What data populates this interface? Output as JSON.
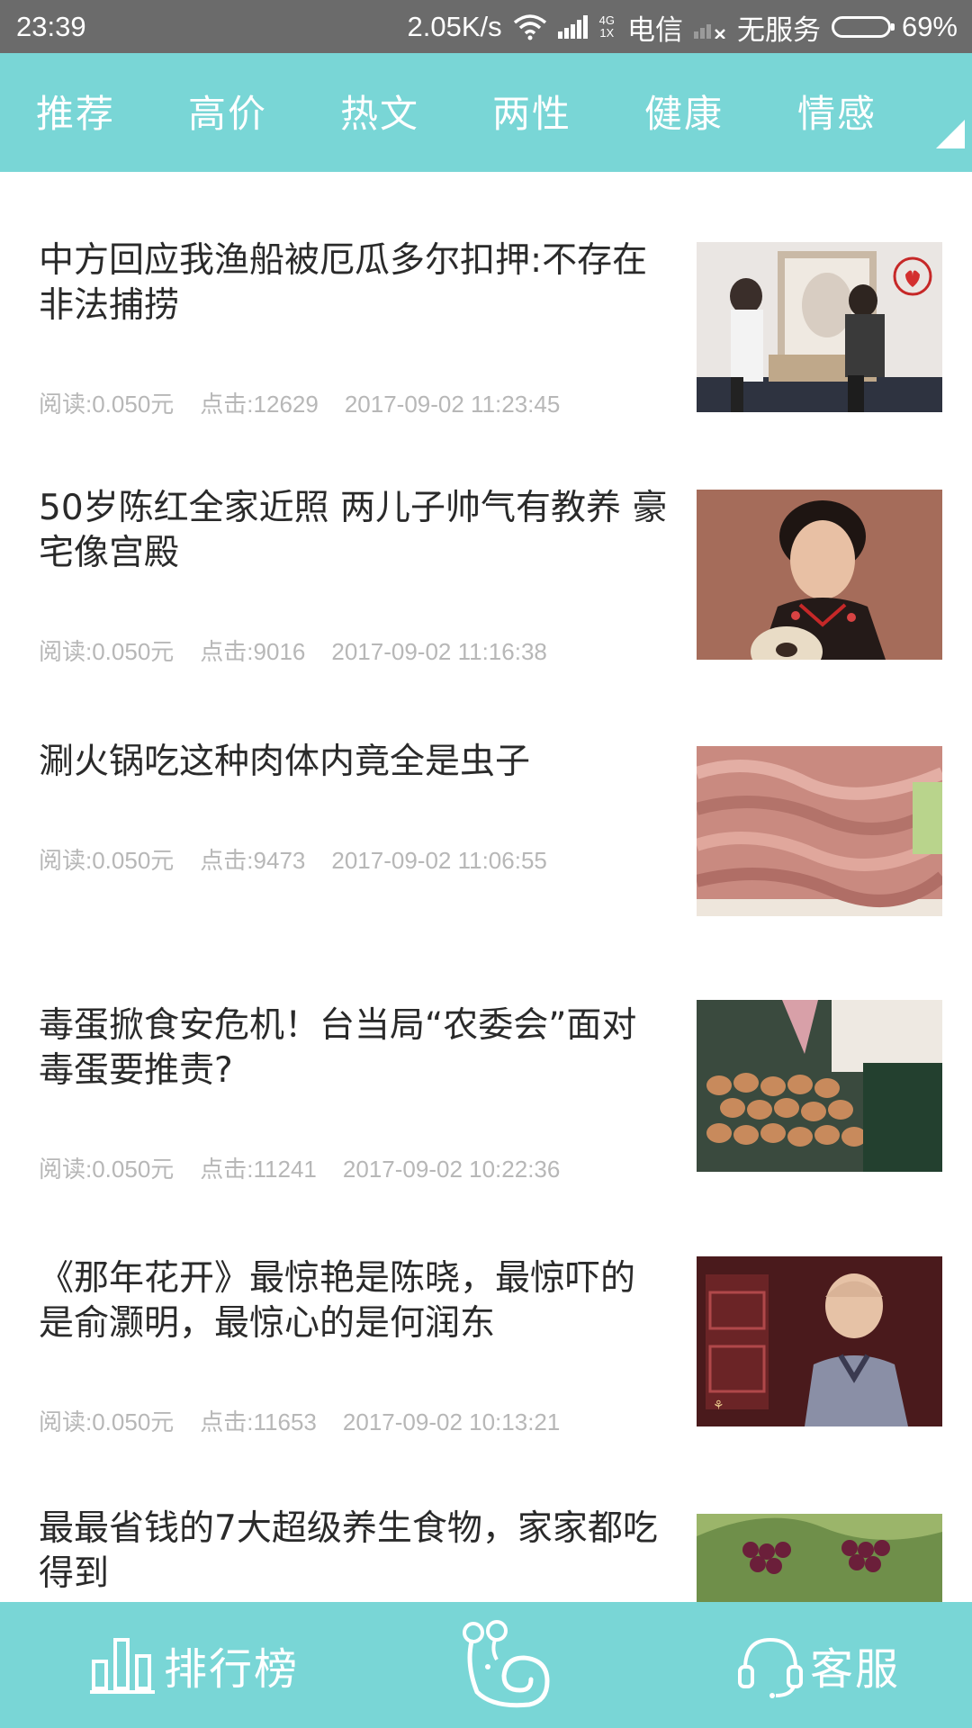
{
  "status_bar": {
    "time": "23:39",
    "net_speed": "2.05K/s",
    "net_type_top": "4G",
    "net_type_bottom": "1X",
    "carrier": "电信",
    "service": "无服务",
    "battery_percent": "69%",
    "battery_level": 0.69
  },
  "tabs": [
    {
      "label": "推荐"
    },
    {
      "label": "高价"
    },
    {
      "label": "热文"
    },
    {
      "label": "两性"
    },
    {
      "label": "健康"
    },
    {
      "label": "情感"
    }
  ],
  "articles": [
    {
      "title": "中方回应我渔船被厄瓜多尔扣押:不存在非法捕捞",
      "read": "阅读:0.050元",
      "clicks": "点击:12629",
      "time": "2017-09-02 11:23:45",
      "thumb_icon": "couple-photo-thumbnail"
    },
    {
      "title": "50岁陈红全家近照 两儿子帅气有教养 豪宅像宫殿",
      "read": "阅读:0.050元",
      "clicks": "点击:9016",
      "time": "2017-09-02 11:16:38",
      "thumb_icon": "woman-with-dog-thumbnail"
    },
    {
      "title": "涮火锅吃这种肉体内竟全是虫子",
      "read": "阅读:0.050元",
      "clicks": "点击:9473",
      "time": "2017-09-02 11:06:55",
      "thumb_icon": "raw-meat-thumbnail"
    },
    {
      "title": "毒蛋掀食安危机！台当局“农委会”面对毒蛋要推责?",
      "read": "阅读:0.050元",
      "clicks": "点击:11241",
      "time": "2017-09-02 10:22:36",
      "thumb_icon": "eggs-thumbnail"
    },
    {
      "title": "《那年花开》最惊艳是陈晓，最惊吓的是俞灏明，最惊心的是何润东",
      "read": "阅读:0.050元",
      "clicks": "点击:11653",
      "time": "2017-09-02 10:13:21",
      "thumb_icon": "actor-portrait-thumbnail"
    },
    {
      "title": "最最省钱的7大超级养生食物，家家都吃得到",
      "read": "",
      "clicks": "",
      "time": "",
      "thumb_icon": "grapes-thumbnail"
    }
  ],
  "bottom_bar": {
    "ranking_label": "排行榜",
    "service_label": "客服",
    "center_icon": "snail-mascot-icon"
  },
  "colors": {
    "accent": "#79d6d6",
    "status_bar": "#6b6b6b",
    "title_text": "#2a2a2a",
    "meta_text": "#b7b7b7"
  }
}
